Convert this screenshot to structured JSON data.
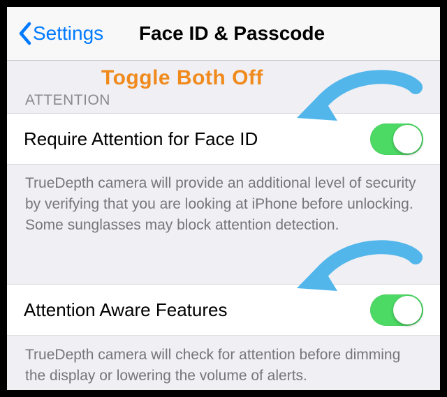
{
  "navbar": {
    "back_label": "Settings",
    "title": "Face ID & Passcode"
  },
  "annotation": {
    "text": "Toggle Both Off"
  },
  "section": {
    "header": "ATTENTION",
    "items": [
      {
        "label": "Require Attention for Face ID",
        "toggle_on": true,
        "footer": "TrueDepth camera will provide an additional level of security by verifying that you are looking at iPhone before unlocking. Some sunglasses may block attention detection."
      },
      {
        "label": "Attention Aware Features",
        "toggle_on": true,
        "footer": "TrueDepth camera will check for attention before dimming the display or lowering the volume of alerts."
      }
    ]
  },
  "colors": {
    "accent": "#007aff",
    "switch_on": "#4cd964",
    "annotation": "#f08a1c",
    "arrow": "#53b6eb"
  }
}
